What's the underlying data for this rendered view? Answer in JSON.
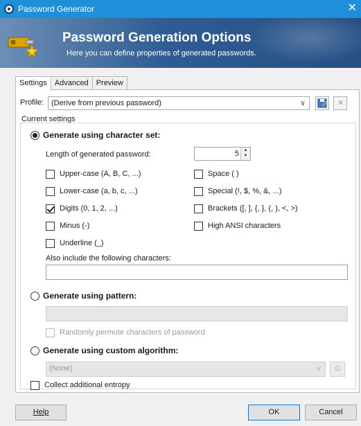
{
  "window": {
    "title": "Password Generator",
    "close_glyph": "✕"
  },
  "banner": {
    "heading": "Password Generation Options",
    "subheading": "Here you can define properties of generated passwords."
  },
  "tabs": [
    {
      "label": "Settings",
      "active": true
    },
    {
      "label": "Advanced",
      "active": false
    },
    {
      "label": "Preview",
      "active": false
    }
  ],
  "profile": {
    "label": "Profile:",
    "value": "(Derive from previous password)",
    "save_icon": "save-profile-icon",
    "delete_icon": "delete-profile-icon"
  },
  "current_settings": {
    "label": "Current settings",
    "charset": {
      "label": "Generate using character set:",
      "selected": true,
      "length_label": "Length of generated password:",
      "length_value": "5",
      "options_left": [
        {
          "label": "Upper-case (A, B, C, ...)",
          "checked": false
        },
        {
          "label": "Lower-case (a, b, c, ...)",
          "checked": false
        },
        {
          "label": "Digits (0, 1, 2, ...)",
          "checked": true
        },
        {
          "label": "Minus (-)",
          "checked": false
        },
        {
          "label": "Underline (_)",
          "checked": false
        }
      ],
      "options_right": [
        {
          "label": "Space ( )",
          "checked": false
        },
        {
          "label": "Special (!, $, %, &, ...)",
          "checked": false
        },
        {
          "label": "Brackets ([, ], {, }, (, ), <, >)",
          "checked": false
        },
        {
          "label": "High ANSI characters",
          "checked": false
        }
      ],
      "also_include_label": "Also include the following characters:",
      "also_include_value": ""
    },
    "pattern": {
      "label": "Generate using pattern:",
      "selected": false,
      "value": "",
      "permute_label": "Randomly permute characters of password",
      "permute_checked": false
    },
    "custom": {
      "label": "Generate using custom algorithm:",
      "selected": false,
      "value": "(None)"
    },
    "entropy": {
      "label": "Collect additional entropy",
      "checked": false
    }
  },
  "buttons": {
    "help": "Help",
    "ok": "OK",
    "cancel": "Cancel"
  },
  "colors": {
    "titlebar": "#1e8fd8",
    "banner_dark": "#254f85",
    "accent_border": "#0078d7"
  }
}
